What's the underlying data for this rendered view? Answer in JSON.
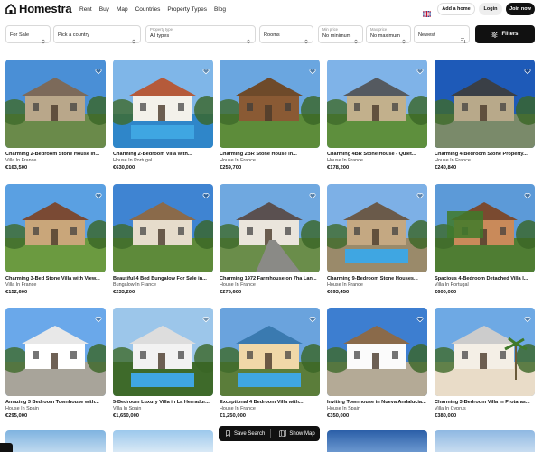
{
  "brand": {
    "name": "Homestra"
  },
  "nav": [
    {
      "label": "Rent"
    },
    {
      "label": "Buy"
    },
    {
      "label": "Map"
    },
    {
      "label": "Countries"
    },
    {
      "label": "Property Types"
    },
    {
      "label": "Blog"
    }
  ],
  "header": {
    "language_icon": "uk-flag-icon",
    "add_home_label": "Add a home",
    "login_label": "Login",
    "join_label": "Join now"
  },
  "filters": {
    "listing_type": "For Sale",
    "country_placeholder": "Pick a country",
    "property_type_label": "Property type",
    "property_type_value": "All types",
    "rooms_placeholder": "Rooms",
    "min_price_label": "Min price",
    "min_price_value": "No minimum",
    "max_price_label": "Max price",
    "max_price_value": "No maximum",
    "sort_value": "Newest",
    "filters_button": "Filters"
  },
  "listings": [
    {
      "title": "Charming 2-Bedroom Stone House in...",
      "subtitle": "Villa In France",
      "price": "€163,500"
    },
    {
      "title": "Charming 2-Bedroom Villa with...",
      "subtitle": "House In Portugal",
      "price": "€630,000"
    },
    {
      "title": "Charming 2BR Stone House in...",
      "subtitle": "House In France",
      "price": "€259,700"
    },
    {
      "title": "Charming 4BR Stone House - Quiet...",
      "subtitle": "House In France",
      "price": "€178,200"
    },
    {
      "title": "Charming 4 Bedroom Stone Property...",
      "subtitle": "House In France",
      "price": "€240,840"
    },
    {
      "title": "Charming 3-Bed Stone Villa with View...",
      "subtitle": "Villa In France",
      "price": "€152,600"
    },
    {
      "title": "Beautiful 4 Bed Bungalow For Sale in...",
      "subtitle": "Bungalow In France",
      "price": "€233,200"
    },
    {
      "title": "Charming 1972 Farmhouse on 7ha Lan...",
      "subtitle": "House In France",
      "price": "€275,600"
    },
    {
      "title": "Charming 9-Bedroom Stone Houses...",
      "subtitle": "House In France",
      "price": "€693,450"
    },
    {
      "title": "Spacious 4-Bedroom Detached Villa I...",
      "subtitle": "Villa In Portugal",
      "price": "€600,000"
    },
    {
      "title": "Amazing 3 Bedroom Townhouse with...",
      "subtitle": "House In Spain",
      "price": "€295,000"
    },
    {
      "title": "5-Bedroom Luxury Villa in La Herradur...",
      "subtitle": "Villa In Spain",
      "price": "€1,650,000"
    },
    {
      "title": "Exceptional 4 Bedroom Villa with...",
      "subtitle": "House In France",
      "price": "€1,250,000"
    },
    {
      "title": "Inviting Townhouse in Nueva Andalucia...",
      "subtitle": "House In Spain",
      "price": "€350,000"
    },
    {
      "title": "Charming 3-Bedroom Villa in Protaras...",
      "subtitle": "Villa In Cyprus",
      "price": "€380,000"
    }
  ],
  "map_bar": {
    "save_search_label": "Save Search",
    "show_map_label": "Show Map"
  },
  "colors": {
    "primary": "#111111",
    "border": "#d9d9d9",
    "muted_text": "#444444"
  }
}
